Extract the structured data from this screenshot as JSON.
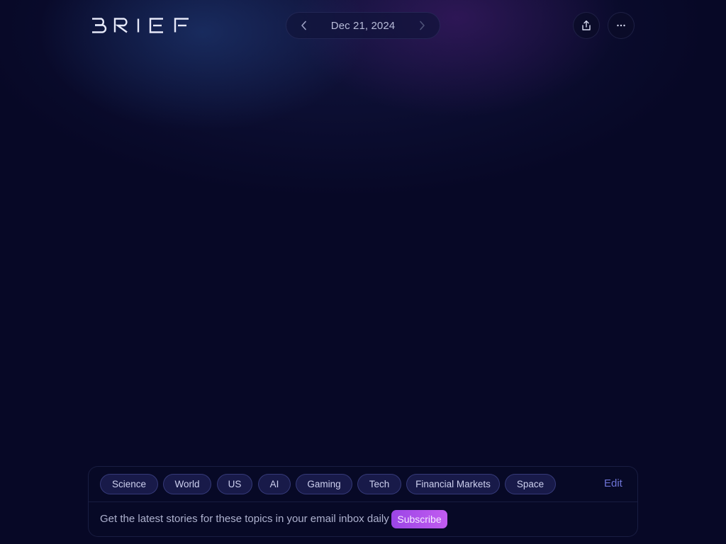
{
  "header": {
    "logo_text": "BRIEF",
    "date": "Dec 21, 2024",
    "prev_icon": "chevron-left-icon",
    "next_icon": "chevron-right-icon",
    "share_icon": "share-icon",
    "more_icon": "more-horizontal-icon"
  },
  "topics": {
    "chips": [
      "Science",
      "World",
      "US",
      "AI",
      "Gaming",
      "Tech",
      "Financial Markets",
      "Space"
    ],
    "edit_label": "Edit"
  },
  "subscribe": {
    "text": "Get the latest stories for these topics in your email inbox daily",
    "button_label": "Subscribe"
  },
  "colors": {
    "background": "#070826",
    "accent": "#6d73d6",
    "subscribe_gradient_start": "#9b45e6",
    "subscribe_gradient_end": "#c25cf0"
  }
}
